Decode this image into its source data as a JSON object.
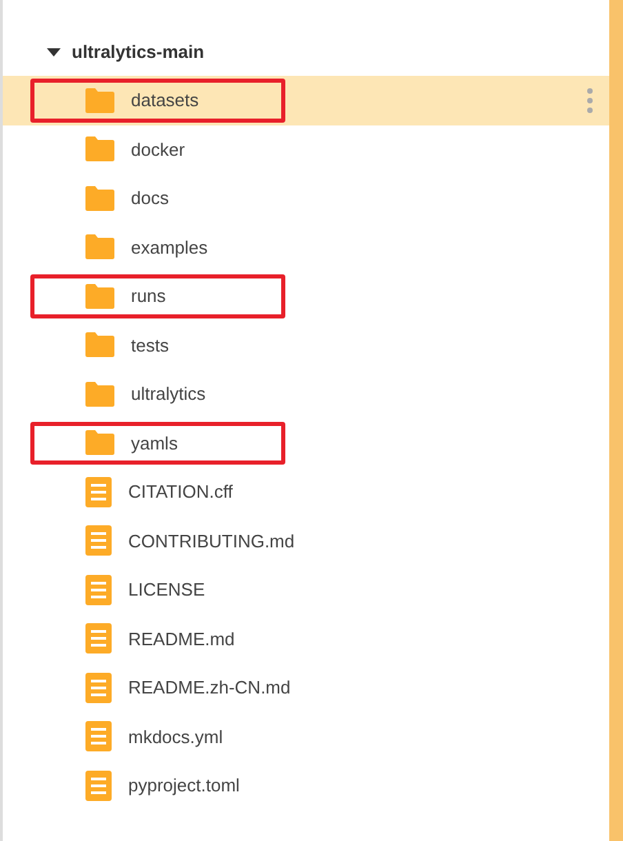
{
  "tree": {
    "label": "ultralytics-main",
    "expanded": true,
    "children": [
      {
        "label": "datasets",
        "kind": "folder",
        "selected": true,
        "highlighted": true
      },
      {
        "label": "docker",
        "kind": "folder",
        "selected": false,
        "highlighted": false
      },
      {
        "label": "docs",
        "kind": "folder",
        "selected": false,
        "highlighted": false
      },
      {
        "label": "examples",
        "kind": "folder",
        "selected": false,
        "highlighted": false
      },
      {
        "label": "runs",
        "kind": "folder",
        "selected": false,
        "highlighted": true
      },
      {
        "label": "tests",
        "kind": "folder",
        "selected": false,
        "highlighted": false
      },
      {
        "label": "ultralytics",
        "kind": "folder",
        "selected": false,
        "highlighted": false
      },
      {
        "label": "yamls",
        "kind": "folder",
        "selected": false,
        "highlighted": true
      },
      {
        "label": "CITATION.cff",
        "kind": "file",
        "selected": false,
        "highlighted": false
      },
      {
        "label": "CONTRIBUTING.md",
        "kind": "file",
        "selected": false,
        "highlighted": false
      },
      {
        "label": "LICENSE",
        "kind": "file",
        "selected": false,
        "highlighted": false
      },
      {
        "label": "README.md",
        "kind": "file",
        "selected": false,
        "highlighted": false
      },
      {
        "label": "README.zh-CN.md",
        "kind": "file",
        "selected": false,
        "highlighted": false
      },
      {
        "label": "mkdocs.yml",
        "kind": "file",
        "selected": false,
        "highlighted": false
      },
      {
        "label": "pyproject.toml",
        "kind": "file",
        "selected": false,
        "highlighted": false
      }
    ]
  }
}
